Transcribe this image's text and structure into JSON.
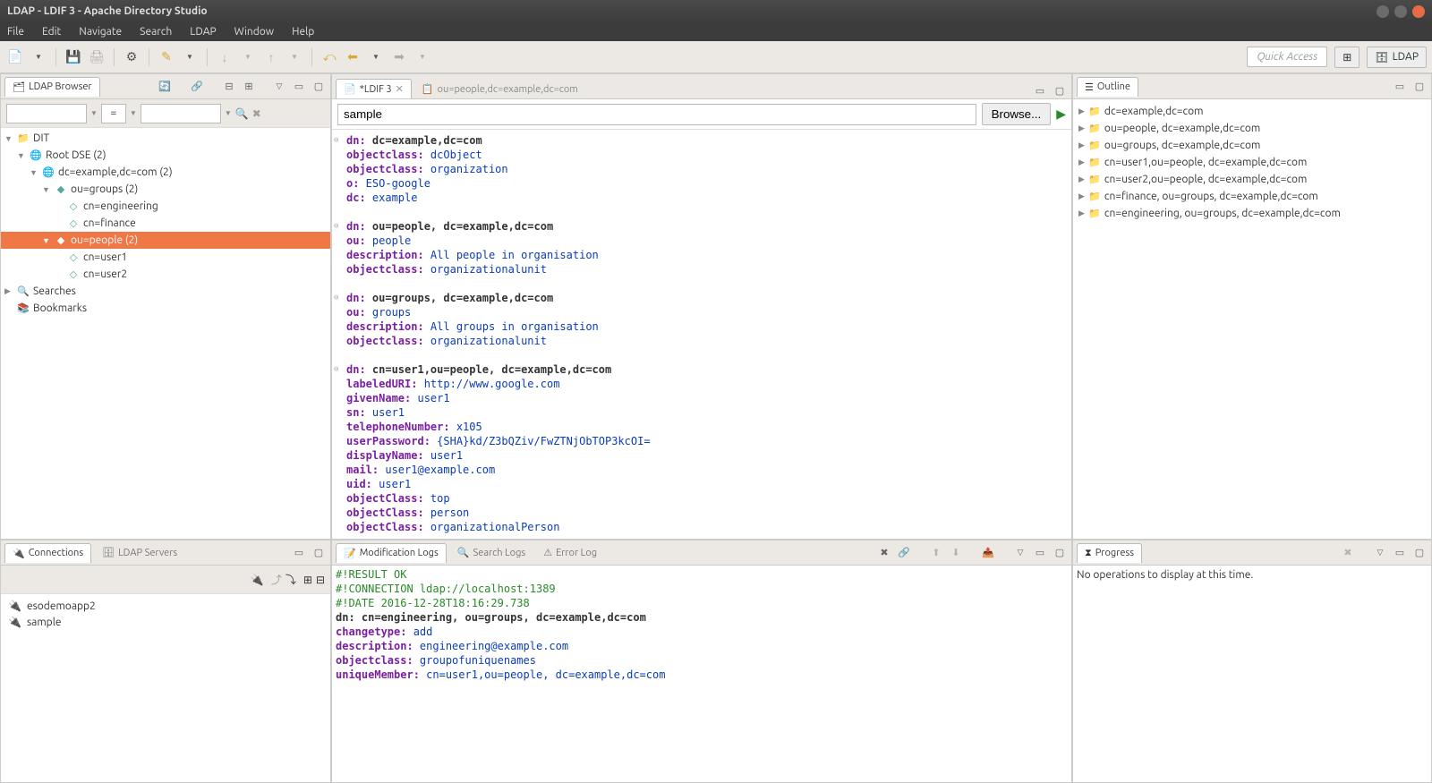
{
  "window": {
    "title": "LDAP - LDIF 3 - Apache Directory Studio"
  },
  "menu": [
    "File",
    "Edit",
    "Navigate",
    "Search",
    "LDAP",
    "Window",
    "Help"
  ],
  "toolbar": {
    "quick_access": "Quick Access",
    "perspective": "LDAP"
  },
  "ldap_browser": {
    "title": "LDAP Browser",
    "tree": {
      "root": "DIT",
      "root_dse": "Root DSE (2)",
      "dc": "dc=example,dc=com (2)",
      "groups": "ou=groups (2)",
      "engineering": "cn=engineering",
      "finance": "cn=finance",
      "people": "ou=people (2)",
      "user1": "cn=user1",
      "user2": "cn=user2",
      "searches": "Searches",
      "bookmarks": "Bookmarks"
    }
  },
  "editor": {
    "tab1": "*LDIF 3",
    "tab2": "ou=people,dc=example,dc=com",
    "search_value": "sample",
    "browse": "Browse...",
    "ldif": [
      {
        "t": "entry",
        "k": "dn:",
        "v": " dc=example,dc=com"
      },
      {
        "t": "attr",
        "k": "objectclass:",
        "v": " dcObject"
      },
      {
        "t": "attr",
        "k": "objectclass:",
        "v": " organization"
      },
      {
        "t": "attr",
        "k": "o:",
        "v": " ESO-google"
      },
      {
        "t": "attr",
        "k": "dc:",
        "v": " example"
      },
      {
        "t": "blank"
      },
      {
        "t": "entry",
        "k": "dn:",
        "v": " ou=people, dc=example,dc=com"
      },
      {
        "t": "attr",
        "k": "ou:",
        "v": " people"
      },
      {
        "t": "attr",
        "k": "description:",
        "v": " All people in organisation"
      },
      {
        "t": "attr",
        "k": "objectclass:",
        "v": " organizationalunit"
      },
      {
        "t": "blank"
      },
      {
        "t": "entry",
        "k": "dn:",
        "v": " ou=groups, dc=example,dc=com"
      },
      {
        "t": "attr",
        "k": "ou:",
        "v": " groups"
      },
      {
        "t": "attr",
        "k": "description:",
        "v": " All groups in organisation"
      },
      {
        "t": "attr",
        "k": "objectclass:",
        "v": " organizationalunit"
      },
      {
        "t": "blank"
      },
      {
        "t": "entry",
        "k": "dn:",
        "v": " cn=user1,ou=people, dc=example,dc=com"
      },
      {
        "t": "attr",
        "k": "labeledURI:",
        "v": " http://www.google.com"
      },
      {
        "t": "attr",
        "k": "givenName:",
        "v": " user1"
      },
      {
        "t": "attr",
        "k": "sn:",
        "v": " user1"
      },
      {
        "t": "attr",
        "k": "telephoneNumber:",
        "v": " x105"
      },
      {
        "t": "attr",
        "k": "userPassword:",
        "v": " {SHA}kd/Z3bQZiv/FwZTNjObTOP3kcOI="
      },
      {
        "t": "attr",
        "k": "displayName:",
        "v": " user1"
      },
      {
        "t": "attr",
        "k": "mail:",
        "v": " user1@example.com"
      },
      {
        "t": "attr",
        "k": "uid:",
        "v": " user1"
      },
      {
        "t": "attr",
        "k": "objectClass:",
        "v": " top"
      },
      {
        "t": "attr",
        "k": "objectClass:",
        "v": " person"
      },
      {
        "t": "attr",
        "k": "objectClass:",
        "v": " organizationalPerson"
      }
    ]
  },
  "outline": {
    "title": "Outline",
    "items": [
      "dc=example,dc=com",
      "ou=people, dc=example,dc=com",
      "ou=groups, dc=example,dc=com",
      "cn=user1,ou=people, dc=example,dc=com",
      "cn=user2,ou=people, dc=example,dc=com",
      "cn=finance, ou=groups, dc=example,dc=com",
      "cn=engineering, ou=groups, dc=example,dc=com"
    ]
  },
  "connections": {
    "title": "Connections",
    "servers_tab": "LDAP Servers",
    "items": [
      "esodemoapp2",
      "sample"
    ]
  },
  "mod_logs": {
    "tab1": "Modification Logs",
    "tab2": "Search Logs",
    "tab3": "Error Log",
    "lines": [
      {
        "c": "comment",
        "t": "#!RESULT OK"
      },
      {
        "c": "comment",
        "t": "#!CONNECTION ldap://localhost:1389"
      },
      {
        "c": "comment",
        "t": "#!DATE 2016-12-28T18:16:29.738"
      },
      {
        "c": "dn",
        "k": "dn:",
        "v": " cn=engineering, ou=groups, dc=example,dc=com"
      },
      {
        "c": "attr",
        "k": "changetype:",
        "v": " add"
      },
      {
        "c": "attr",
        "k": "description:",
        "v": " engineering@example.com"
      },
      {
        "c": "attr",
        "k": "objectclass:",
        "v": " groupofuniquenames"
      },
      {
        "c": "attr",
        "k": "uniqueMember:",
        "v": " cn=user1,ou=people, dc=example,dc=com"
      }
    ]
  },
  "progress": {
    "title": "Progress",
    "message": "No operations to display at this time."
  }
}
